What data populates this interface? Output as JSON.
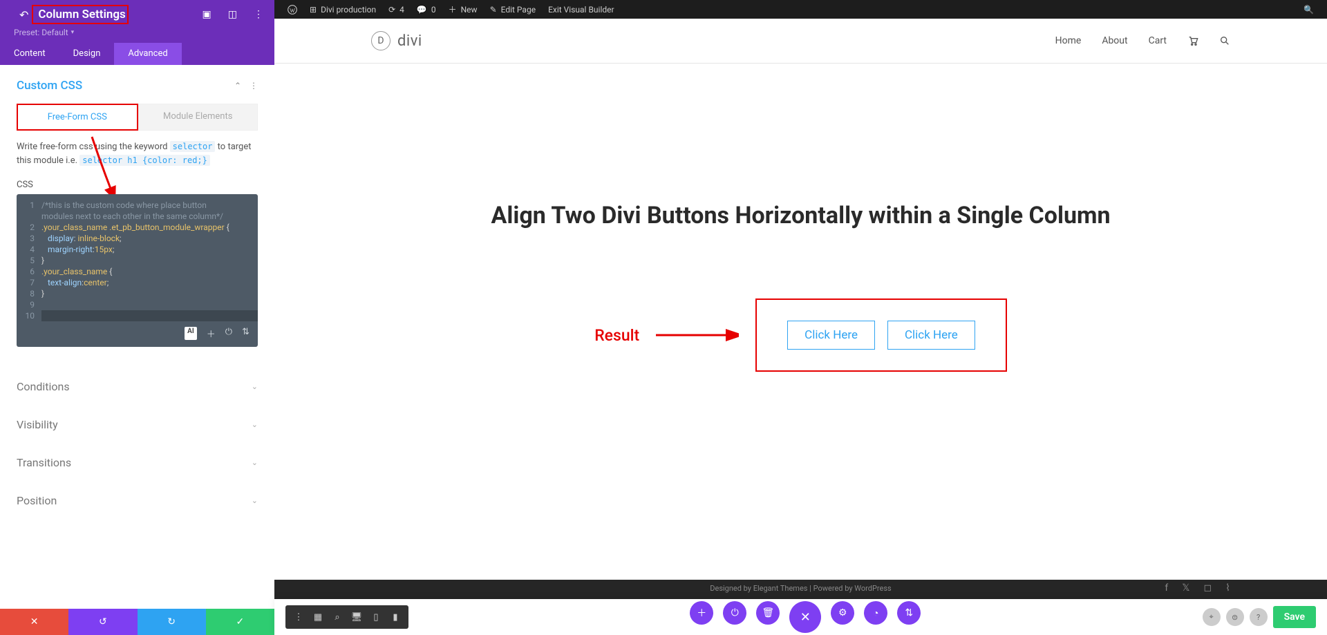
{
  "panel": {
    "title": "Column Settings",
    "preset": "Preset: Default",
    "tabs": [
      "Content",
      "Design",
      "Advanced"
    ],
    "active_tab": 2,
    "section": {
      "title": "Custom CSS",
      "subtabs": [
        "Free-Form CSS",
        "Module Elements"
      ],
      "help_pre": "Write free-form css using the keyword ",
      "help_kw1": "selector",
      "help_mid": " to target this module i.e. ",
      "help_kw2": "selector h1 {color: red;}",
      "css_label": "CSS"
    },
    "accordions": [
      "Conditions",
      "Visibility",
      "Transitions",
      "Position"
    ]
  },
  "code": {
    "l1": "/*this is the custom code where place button",
    "l1b": "modules next to each other in the same column*/",
    "l2_sel": ".your_class_name .et_pb_button_module_wrapper",
    "l3_prop": "display",
    "l3_val": "inline-block",
    "l4_prop": "margin-right",
    "l4_val": "15px",
    "l6_sel": ".your_class_name",
    "l7_prop": "text-align",
    "l7_val": "center"
  },
  "wpbar": {
    "site": "Divi production",
    "updates": "4",
    "comments": "0",
    "new": "New",
    "edit": "Edit Page",
    "exit": "Exit Visual Builder"
  },
  "site": {
    "logo": "divi",
    "nav": [
      "Home",
      "About",
      "Cart"
    ],
    "hero": "Align Two Divi Buttons Horizontally within a Single Column",
    "result_label": "Result",
    "btn1": "Click Here",
    "btn2": "Click Here",
    "footer_text": "Designed by Elegant Themes | Powered by WordPress"
  },
  "builder": {
    "save": "Save"
  },
  "ai": "AI"
}
